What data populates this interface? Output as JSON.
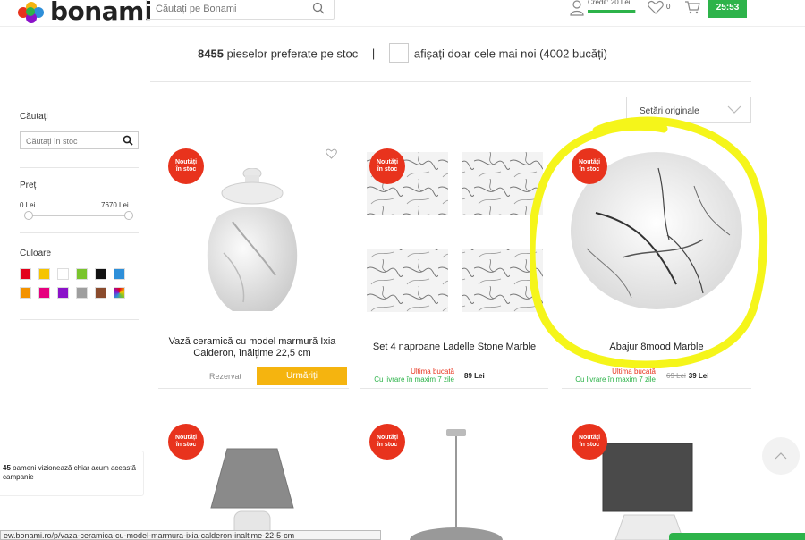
{
  "header": {
    "logo_text": "bonami",
    "search_placeholder": "Căutați pe Bonami",
    "credit_label": "Credit: 20 Lei",
    "credit_value": "",
    "wishlist_count": "0",
    "timer": "25:53"
  },
  "stock_bar": {
    "count": "8455",
    "text": "pieselor preferate pe stoc",
    "separator": "|",
    "newest_label": "afișați doar cele mai noi (4002 bucăți)"
  },
  "sidebar": {
    "search_title": "Căutați",
    "search_placeholder": "Căutați în stoc",
    "price_title": "Preț",
    "price_min": "0 Lei",
    "price_max": "7670 Lei",
    "color_title": "Culoare"
  },
  "colors": [
    "#e3001b",
    "#f5c400",
    "#ffffff",
    "#7ac42d",
    "#111111",
    "#2e8fd9",
    "#f39200",
    "#e6007e",
    "#8b12c9",
    "#9e9e9e",
    "#8a4b2d",
    "multicolor"
  ],
  "sort": {
    "label": "Setări originale"
  },
  "products": [
    {
      "badge_line1": "Noutăți",
      "badge_line2": "în stoc",
      "title": "Vază ceramică cu model marmură Ixia Calderon, înălțime 22,5 cm",
      "reserved": "Rezervat",
      "follow": "Urmăriți"
    },
    {
      "badge_line1": "Noutăți",
      "badge_line2": "în stoc",
      "title": "Set 4 naproane Ladelle Stone Marble",
      "last": "Ultima bucată",
      "delivery": "Cu livrare în maxim 7 zile",
      "price": "89 Lei"
    },
    {
      "badge_line1": "Noutăți",
      "badge_line2": "în stoc",
      "title": "Abajur 8mood Marble",
      "last": "Ultima bucată",
      "delivery": "Cu livrare în maxim 7 zile",
      "old_price": "69 Lei",
      "price": "39 Lei"
    },
    {
      "badge_line1": "Noutăți",
      "badge_line2": "în stoc"
    },
    {
      "badge_line1": "Noutăți",
      "badge_line2": "în stoc"
    },
    {
      "badge_line1": "Noutăți",
      "badge_line2": "în stoc"
    }
  ],
  "viewers": {
    "count": "45",
    "text": "oameni vizionează chiar acum această campanie"
  },
  "status_url": "ew.bonami.ro/p/vaza-ceramica-cu-model-marmura-ixia-calderon-inaltime-22-5-cm"
}
